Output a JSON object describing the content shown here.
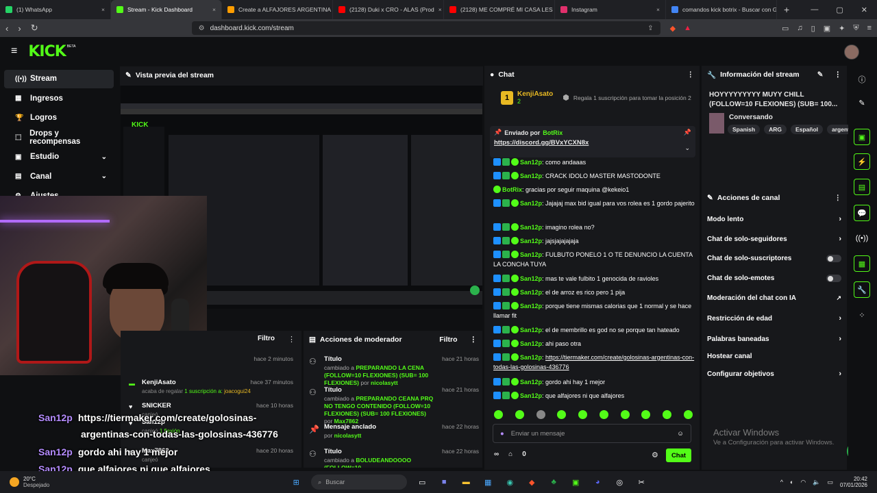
{
  "browser": {
    "tabs": [
      {
        "label": "(1) WhatsApp",
        "color": "#25d366"
      },
      {
        "label": "Stream - Kick Dashboard",
        "color": "#53fc18"
      },
      {
        "label": "Create a ALFAJORES ARGENTINA Tie",
        "color": "#ff9d00"
      },
      {
        "label": "(2128) Duki x CRO - ALAS (Prod",
        "color": "#ff0000"
      },
      {
        "label": "(2128) ME COMPRÉ MI CASA LES M",
        "color": "#ff0000"
      },
      {
        "label": "Instagram",
        "color": "#e1306c"
      },
      {
        "label": "comandos kick botrix - Buscar con G",
        "color": "#4285f4"
      }
    ],
    "url": "dashboard.kick.com/stream"
  },
  "kick": {
    "logo": "KICK",
    "beta": "BETA"
  },
  "sidebar": {
    "items": [
      {
        "label": "Stream",
        "icon": "broadcast-icon",
        "glyph": "((•))",
        "active": true
      },
      {
        "label": "Ingresos",
        "icon": "money-icon",
        "glyph": "▦",
        "active": false
      },
      {
        "label": "Logros",
        "icon": "trophy-icon",
        "glyph": "🏆",
        "active": false
      },
      {
        "label": "Drops y recompensas",
        "icon": "gift-icon",
        "glyph": "⬚",
        "active": false
      },
      {
        "label": "Estudio",
        "icon": "studio-icon",
        "glyph": "▣",
        "chevron": true
      },
      {
        "label": "Canal",
        "icon": "channel-icon",
        "glyph": "▤",
        "chevron": true
      },
      {
        "label": "Ajustes",
        "icon": "gear-icon",
        "glyph": "⚙",
        "chevron": true
      }
    ]
  },
  "preview": {
    "title": "Vista previa del stream"
  },
  "overlay_chat": [
    {
      "user": "San12p",
      "text": "https://tiermaker.com/create/golosinas-"
    },
    {
      "user": "",
      "text": "argentinas-con-todas-las-golosinas-436776"
    },
    {
      "user": "San12p",
      "text": "gordo ahi hay 1 mejor"
    },
    {
      "user": "San12p",
      "text": "que alfajores ni que alfajores"
    }
  ],
  "feed": {
    "filter_label": "Filtro",
    "items": [
      {
        "time": "hace 2 minutos"
      },
      {
        "user": "KenjiAsato",
        "text": "acaba de regalar",
        "amount": "1 suscripción a:",
        "target": "joacogui24",
        "time": "hace 37 minutos"
      },
      {
        "user": "SNICKER",
        "text": "canjeó",
        "time": "hace 10 horas"
      },
      {
        "user": "San12p",
        "text": "canjeó",
        "amount": "1 flexión",
        "time": ""
      },
      {
        "user": "Max7862",
        "text": "canjeó",
        "time": "hace 20 horas"
      }
    ]
  },
  "mod_actions": {
    "title": "Acciones de moderador",
    "filter_label": "Filtro",
    "items": [
      {
        "title": "Título",
        "time": "hace 21 horas",
        "desc": "PREPARANDO LA CENA (FOLLOW=10 FLEXIONES) (SUB= 100 FLEXIONES)",
        "prefix": "cambiado a",
        "by": "nicolasytt"
      },
      {
        "title": "Título",
        "time": "hace 21 horas",
        "desc": "PREPARANDO CEANA PRQ NO TENGO CONTENIDO (FOLLOW=10 FLEXIONES) (SUB= 100 FLEXIONES)",
        "prefix": "cambiado a",
        "by": "Max7862"
      },
      {
        "title": "Mensaje anclado",
        "time": "hace 22 horas",
        "desc": "",
        "prefix": "por",
        "by": "nicolasytt"
      },
      {
        "title": "Título",
        "time": "hace 22 horas",
        "desc": "BOLUDEANDOOOO (FOLLOW=10",
        "prefix": "cambiado a",
        "by": ""
      }
    ]
  },
  "chat": {
    "title": "Chat",
    "top_gifter": {
      "name": "KenjiAsato",
      "rank": "1",
      "count": "2",
      "cta": "Regala 1 suscripción para tomar la posición 2"
    },
    "pinned": {
      "label": "Enviado por",
      "user": "BotRix",
      "link": "https://discord.gg/BVxYCXN8x"
    },
    "messages": [
      {
        "user": "San12p",
        "text": "como andaaas"
      },
      {
        "user": "San12p",
        "text": "CRACK IDOLO MASTER MASTODONTE"
      },
      {
        "user": "BotRix",
        "text": "gracias por seguir maquina @kekeio1"
      },
      {
        "user": "San12p",
        "text": "Jajajaj max bid igual para vos rolea es 1 gordo pajerito"
      },
      {
        "user": "San12p",
        "text": "imagino rolea no?"
      },
      {
        "user": "San12p",
        "text": "jajsjajajajaja"
      },
      {
        "user": "San12p",
        "text": "FULBUTO PONELO 1 O TE DENUNCIO LA CUENTA LA CONCHA TUYA"
      },
      {
        "user": "San12p",
        "text": "mas te vale fulbito 1 genocida de ravioles"
      },
      {
        "user": "San12p",
        "text": "el de arroz es rico pero 1 pija"
      },
      {
        "user": "San12p",
        "text": "porque tiene mismas calorias que 1 normal y se hace llamar fit"
      },
      {
        "user": "San12p",
        "text": "el de membrillo es god no se porque tan hateado"
      },
      {
        "user": "San12p",
        "text": "ahi paso otra"
      },
      {
        "user": "San12p",
        "text": "https://tiermaker.com/create/golosinas-argentinas-con-todas-las-golosinas-436776"
      },
      {
        "user": "San12p",
        "text": "gordo ahi hay 1 mejor"
      },
      {
        "user": "San12p",
        "text": "que alfajores ni que alfajores"
      }
    ],
    "input_placeholder": "Enviar un mensaje",
    "points": "0",
    "send_label": "Chat"
  },
  "stream_info": {
    "title_label": "Información del stream",
    "stream_title": "HOYYYYYYYYY MUYY CHILL (FOLLOW=10 FLEXIONES) (SUB= 100...",
    "category": "Conversando",
    "tags": [
      "Spanish",
      "ARG",
      "Español",
      "argentin"
    ]
  },
  "channel_actions": {
    "title": "Acciones de canal",
    "items": [
      {
        "label": "Modo lento",
        "kind": "chevron"
      },
      {
        "label": "Chat de solo-seguidores",
        "kind": "chevron"
      },
      {
        "label": "Chat de solo-suscriptores",
        "kind": "toggle"
      },
      {
        "label": "Chat de solo-emotes",
        "kind": "toggle"
      },
      {
        "label": "Moderación del chat con IA",
        "kind": "external"
      },
      {
        "label": "Restricción de edad",
        "kind": "chevron"
      },
      {
        "label": "Palabras baneadas",
        "kind": "chevron"
      },
      {
        "label": "Hostear canal",
        "kind": "none"
      },
      {
        "label": "Configurar objetivos",
        "kind": "chevron"
      }
    ]
  },
  "windows": {
    "activate_title": "Activar Windows",
    "activate_sub": "Ve a Configuración para activar Windows.",
    "weather_temp": "20°C",
    "weather_desc": "Despejado",
    "search_label": "Buscar",
    "time": "20:42",
    "date": "07/01/2026"
  },
  "colors": {
    "kick_green": "#53fc18",
    "username_purple": "#b58cff",
    "bg": "#0f1012",
    "panel": "#17181b"
  }
}
